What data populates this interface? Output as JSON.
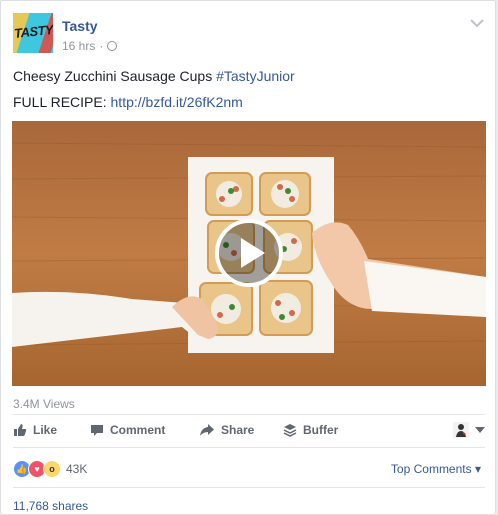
{
  "post": {
    "page_name": "Tasty",
    "time": "16 hrs",
    "dot": "·",
    "avatar_text": "TASTY",
    "caption_text": "Cheesy Zucchini Sausage Cups ",
    "caption_hashtag": "#TastyJunior",
    "recipe_label": "FULL RECIPE: ",
    "recipe_link": "http://bzfd.it/26fK2nm"
  },
  "video": {
    "views": "3.4M Views"
  },
  "actions": {
    "like": "Like",
    "comment": "Comment",
    "share": "Share",
    "buffer": "Buffer"
  },
  "reactions": {
    "count": "43K",
    "top_comments": "Top Comments",
    "shares": "11,768 shares",
    "colors": {
      "like": "#5890ff",
      "love": "#f25268",
      "wow": "#fcd669"
    }
  },
  "icons": [
    "chevron-down-icon",
    "globe-icon",
    "play-icon",
    "like-icon",
    "comment-icon",
    "share-icon",
    "buffer-icon",
    "user-avatar-icon",
    "caret-down-icon"
  ]
}
